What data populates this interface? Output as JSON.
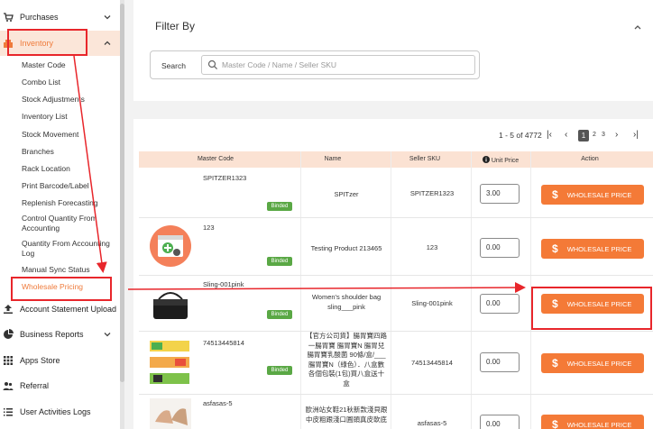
{
  "sidebar": {
    "purchases": "Purchases",
    "inventory": "Inventory",
    "sub_items": [
      "Master Code",
      "Combo List",
      "Stock Adjustments",
      "Inventory List",
      "Stock Movement",
      "Branches",
      "Rack Location",
      "Print Barcode/Label",
      "Replenish Forecasting",
      "Control Quantity From Accounting",
      "Quantity From Accounting Log",
      "Manual Sync Status",
      "Wholesale Pricing"
    ],
    "account_statement": "Account Statement Upload",
    "business_reports": "Business Reports",
    "apps_store": "Apps Store",
    "referral": "Referral",
    "user_activities": "User Activities Logs"
  },
  "filter": {
    "title": "Filter By",
    "search_label": "Search",
    "search_placeholder": "Master Code / Name / Seller SKU"
  },
  "pagination": {
    "range": "1 - 5 of 4772",
    "current": "1",
    "pages": [
      "2",
      "3"
    ]
  },
  "table": {
    "headers": [
      "Master Code",
      "Name",
      "Seller SKU",
      "Unit Price",
      "Action"
    ],
    "badge": "Binded",
    "action_label": "WHOLESALE PRICE",
    "rows": [
      {
        "code": "SPITZER1323",
        "name": "SPITzer",
        "sku": "SPITZER1323",
        "price": "3.00"
      },
      {
        "code": "123",
        "name": "Testing Product 213465",
        "sku": "123",
        "price": "0.00"
      },
      {
        "code": "Sling-001pink",
        "name_l1": "Women's shoulder bag",
        "name_l2": "sling___pink",
        "sku": "Sling-001pink",
        "price": "0.00"
      },
      {
        "code": "74513445814",
        "name_lines": [
          "【官方公司貨】腸胃寶四路",
          "一腸胃寶 腸胃寶N 腸胃兒",
          "腸胃寶乳酸菌 90條/盒/___",
          "腸胃寶N（綠色）．八盒數",
          "各個包裝(1包)買八盒送十",
          "盒"
        ],
        "sku": "74513445814",
        "price": "0.00"
      },
      {
        "code": "asfasas-5",
        "name_lines": [
          "歐洲站女鞋21秋新款淺貝跟",
          "中皮粗跟淺口圓頭真皮軟底"
        ],
        "sku": "asfasas-5",
        "price": "0.00"
      }
    ]
  },
  "colors": {
    "accent": "#f47a37",
    "active_bg": "#fbe6d9",
    "annotation": "#e8262b",
    "badge": "#5aa845"
  }
}
